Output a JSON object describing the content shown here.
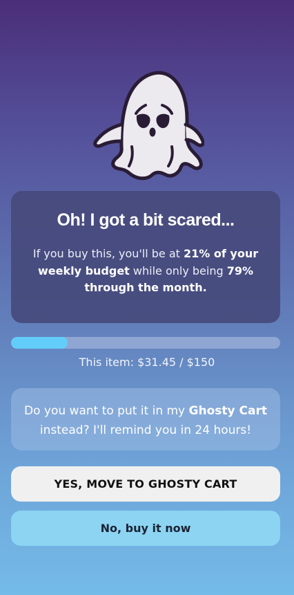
{
  "ghost": {
    "icon": "sad-ghost-icon"
  },
  "card": {
    "title": "Oh! I got a bit scared...",
    "msg_part1": "If you buy this, you'll be at ",
    "budget_percent": "21%",
    "msg_part2": " of your weekly budget",
    "msg_part3": " while only being ",
    "month_percent": "79%",
    "msg_part4": " through the month."
  },
  "progress": {
    "fraction": 0.21,
    "fill_color": "#63cdf9",
    "track_color": "#8fa6d2"
  },
  "item_label": "This item: $31.45 / $150",
  "prompt": {
    "part1": "Do you want to put it in my ",
    "cart_name": "Ghosty Cart",
    "part2": " instead? I'll remind you in 24 hours!"
  },
  "buttons": {
    "yes": "YES, MOVE TO GHOSTY CART",
    "no": "No, buy it now"
  }
}
